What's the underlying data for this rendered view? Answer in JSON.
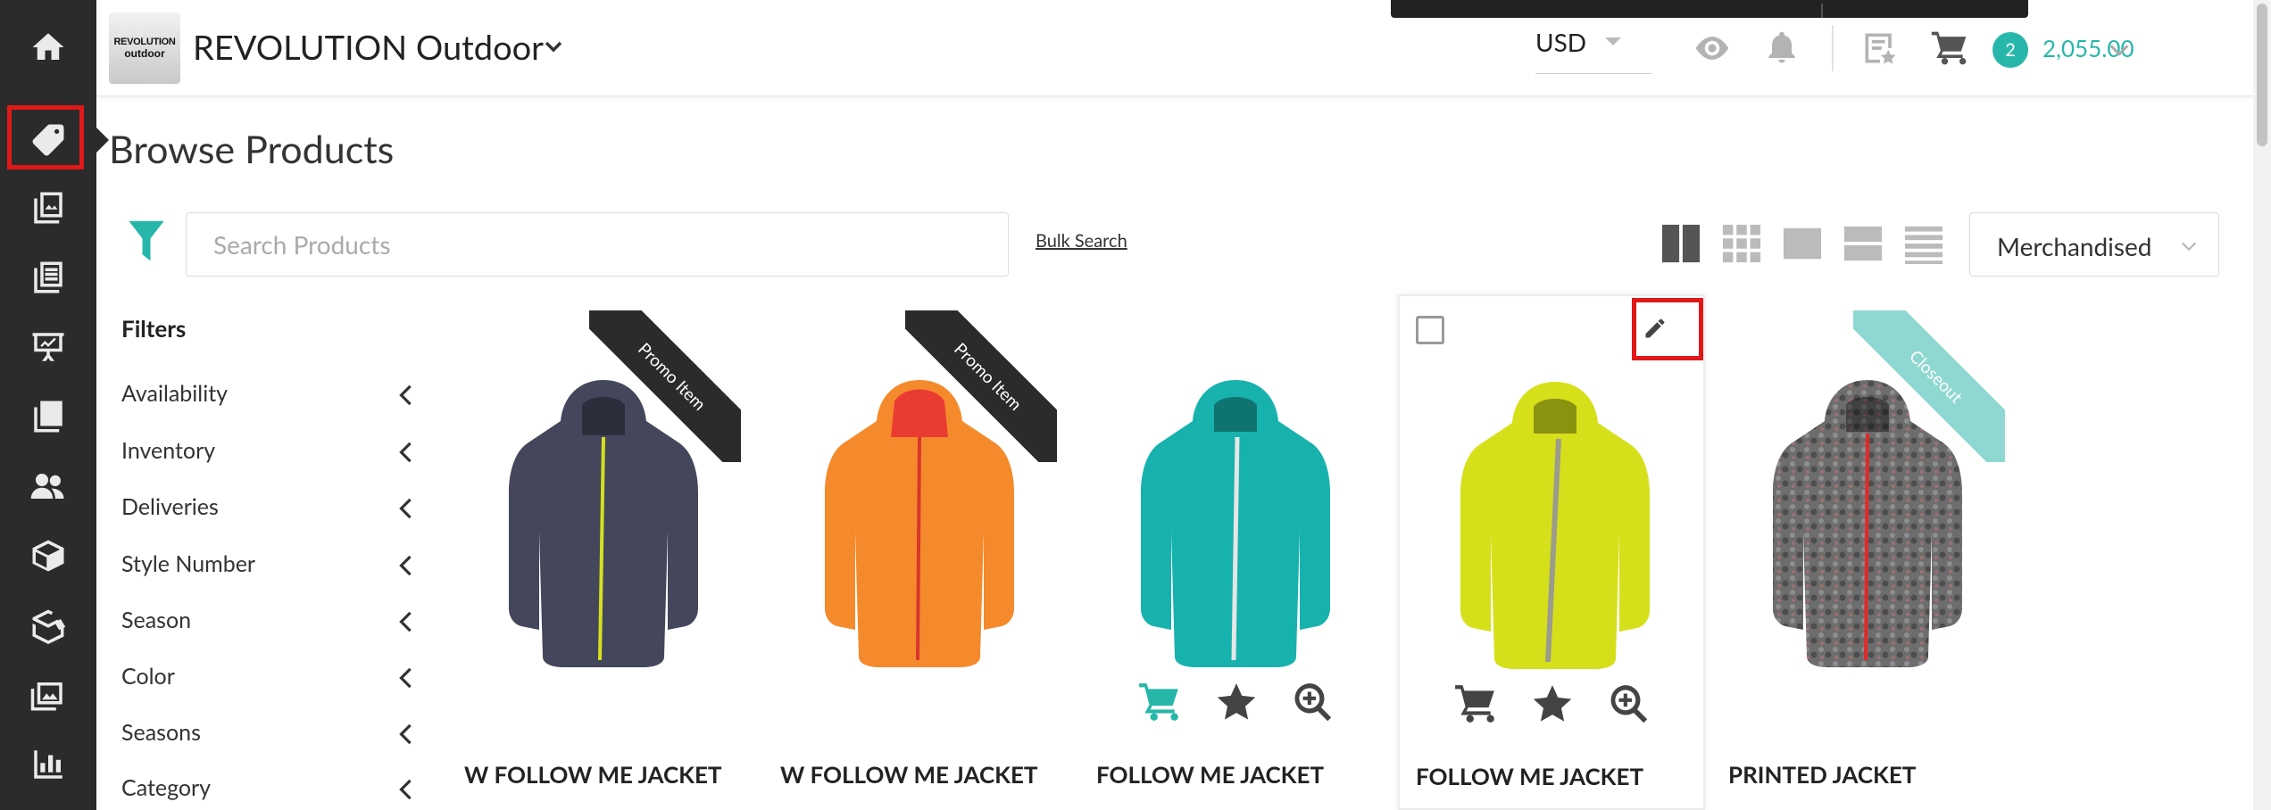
{
  "app": {
    "store_name": "REVOLUTION Outdoor",
    "logo_line1": "REVOLUTION",
    "logo_line2": "outdoor"
  },
  "sidebar": {
    "items": [
      {
        "icon": "home-icon"
      },
      {
        "icon": "tag-icon",
        "active": true
      },
      {
        "icon": "catalog-icon"
      },
      {
        "icon": "list-icon"
      },
      {
        "icon": "presentation-icon"
      },
      {
        "icon": "checklist-icon"
      },
      {
        "icon": "users-icon"
      },
      {
        "icon": "box-icon"
      },
      {
        "icon": "envelope-tag-icon"
      },
      {
        "icon": "images-icon"
      },
      {
        "icon": "bar-chart-icon"
      }
    ]
  },
  "topbar": {
    "currency": "USD",
    "cart_count": "2",
    "cart_total": "2,055.00"
  },
  "page": {
    "title": "Browse Products"
  },
  "toolbar": {
    "search_placeholder": "Search Products",
    "bulk_search": "Bulk Search",
    "sort_value": "Merchandised"
  },
  "filters": {
    "title": "Filters",
    "items": [
      "Availability",
      "Inventory",
      "Deliveries",
      "Style Number",
      "Season",
      "Color",
      "Seasons",
      "Category"
    ]
  },
  "products": [
    {
      "name": "W FOLLOW ME JACKET",
      "ribbon": "Promo Item",
      "color": "#44475c",
      "zip": "#d6e01e"
    },
    {
      "name": "W FOLLOW ME JACKET",
      "ribbon": "Promo Item",
      "color": "#f58a2c",
      "zip": "#d9362b"
    },
    {
      "name": "FOLLOW ME JACKET",
      "ribbon": "",
      "color": "#17b2ad",
      "zip": "#e6e6e6"
    },
    {
      "name": "FOLLOW ME JACKET",
      "ribbon": "",
      "color": "#d6e01a",
      "zip": "#9c9c8c"
    },
    {
      "name": "PRINTED JACKET",
      "ribbon": "Closeout",
      "color": "#6d6d6d",
      "zip": "#e02a2a"
    }
  ],
  "colors": {
    "accent": "#26b7aa",
    "sidebar_bg": "#2b2b2b",
    "highlight": "#e01818"
  }
}
